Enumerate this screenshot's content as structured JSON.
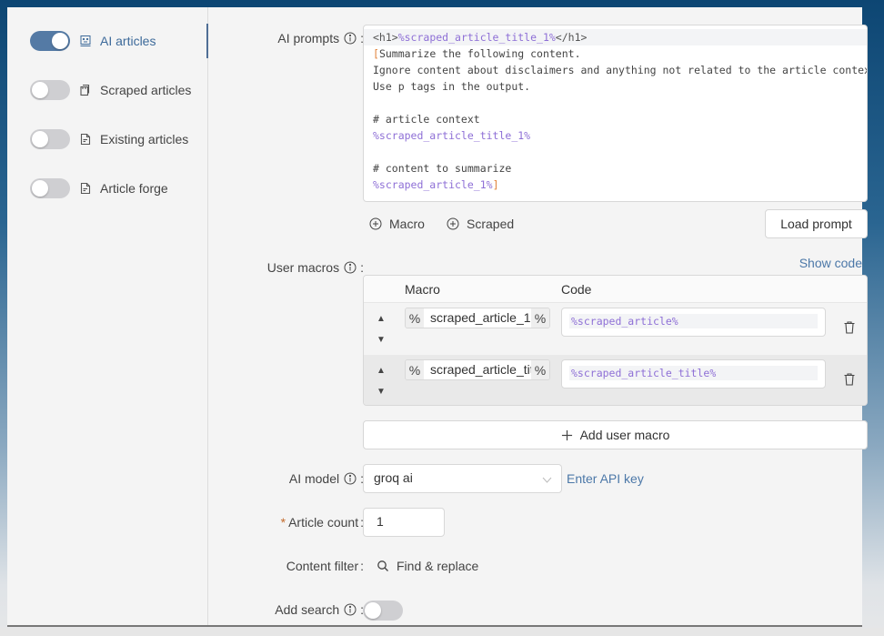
{
  "sidebar": {
    "items": [
      {
        "label": "AI articles",
        "icon": "robot-icon",
        "enabled": true,
        "active": true
      },
      {
        "label": "Scraped articles",
        "icon": "copy-icon",
        "enabled": false,
        "active": false
      },
      {
        "label": "Existing articles",
        "icon": "file-icon",
        "enabled": false,
        "active": false
      },
      {
        "label": "Article forge",
        "icon": "file-icon",
        "enabled": false,
        "active": false
      }
    ]
  },
  "form": {
    "ai_prompts": {
      "label": "AI prompts",
      "separator": ":",
      "lines": [
        {
          "parts": [
            {
              "t": "<h1>",
              "c": "tag"
            },
            {
              "t": "%scraped_article_title_1%",
              "c": "mac"
            },
            {
              "t": "</h1>",
              "c": "tag"
            }
          ],
          "highlight": true
        },
        {
          "parts": [
            {
              "t": "[",
              "c": "brk"
            },
            {
              "t": "Summarize the following content.",
              "c": ""
            }
          ]
        },
        {
          "parts": [
            {
              "t": "Ignore content about disclaimers and anything not related to the article context.",
              "c": ""
            }
          ]
        },
        {
          "parts": [
            {
              "t": "Use p tags in the output.",
              "c": ""
            }
          ]
        },
        {
          "parts": [
            {
              "t": "",
              "c": ""
            }
          ]
        },
        {
          "parts": [
            {
              "t": "# article context",
              "c": ""
            }
          ]
        },
        {
          "parts": [
            {
              "t": "%scraped_article_title_1%",
              "c": "mac"
            }
          ]
        },
        {
          "parts": [
            {
              "t": "",
              "c": ""
            }
          ]
        },
        {
          "parts": [
            {
              "t": "# content to summarize",
              "c": ""
            }
          ]
        },
        {
          "parts": [
            {
              "t": "%scraped_article_1%",
              "c": "mac"
            },
            {
              "t": "]",
              "c": "brk"
            }
          ]
        }
      ],
      "macro_button": "Macro",
      "scraped_button": "Scraped",
      "load_prompt_button": "Load prompt"
    },
    "user_macros": {
      "label": "User macros",
      "separator": ":",
      "show_code_link": "Show code",
      "columns": [
        "Macro",
        "Code"
      ],
      "prefix": "%",
      "suffix": "%",
      "rows": [
        {
          "macro": "scraped_article_1",
          "code": "%scraped_article%"
        },
        {
          "macro": "scraped_article_title",
          "code": "%scraped_article_title%"
        }
      ],
      "add_button": "Add user macro"
    },
    "ai_model": {
      "label": "AI model",
      "separator": ":",
      "value": "groq ai",
      "api_key_link": "Enter API key"
    },
    "article_count": {
      "required_mark": "*",
      "label": "Article count",
      "separator": ":",
      "value": "1"
    },
    "content_filter": {
      "label": "Content filter",
      "separator": ":",
      "find_replace": "Find & replace"
    },
    "add_search": {
      "label": "Add search",
      "separator": ":",
      "enabled": false
    }
  },
  "colors": {
    "accent": "#547aa5",
    "link": "#4c78a8",
    "macro": "#8e6fd6",
    "bracket": "#e2823a",
    "required": "#c46b2c"
  }
}
